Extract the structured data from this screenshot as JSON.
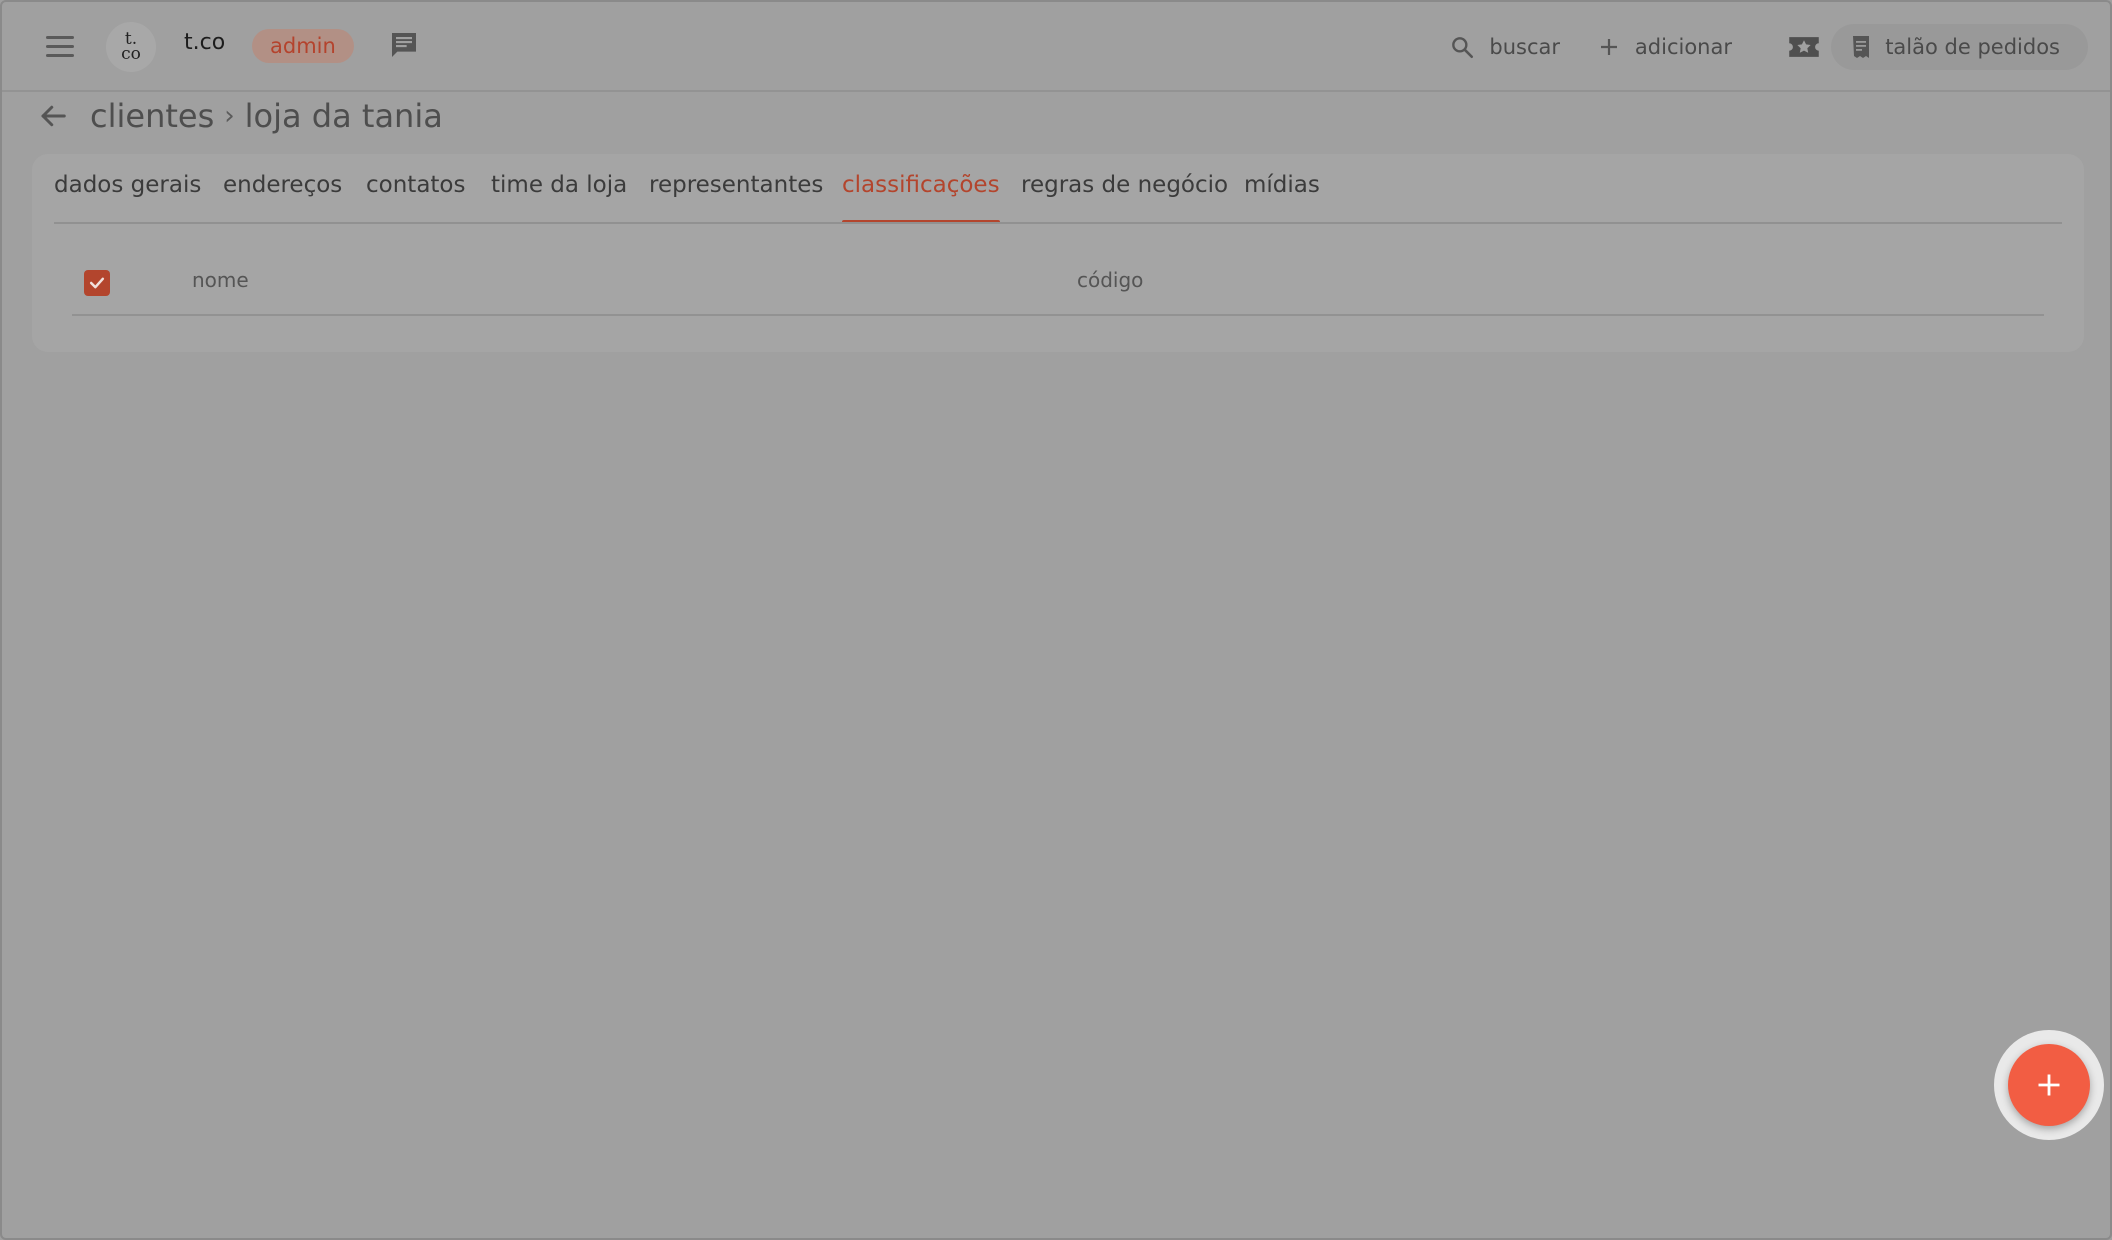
{
  "header": {
    "logo_text": "t.co",
    "company_name": "t.co",
    "role_badge": "admin",
    "search_label": "buscar",
    "add_label": "adicionar",
    "order_book_label": "talão de pedidos"
  },
  "breadcrumb": {
    "parent": "clientes",
    "separator": "›",
    "current": "loja da tania"
  },
  "tabs": [
    {
      "label": "dados gerais",
      "active": false
    },
    {
      "label": "endereços",
      "active": false
    },
    {
      "label": "contatos",
      "active": false
    },
    {
      "label": "time da loja",
      "active": false
    },
    {
      "label": "representantes",
      "active": false
    },
    {
      "label": "classificações",
      "active": true
    },
    {
      "label": "regras de negócio",
      "active": false
    },
    {
      "label": "mídias",
      "active": false
    }
  ],
  "table": {
    "select_all_checked": true,
    "columns": [
      "nome",
      "código"
    ]
  },
  "colors": {
    "accent": "#b3452d",
    "fab": "#f25d43",
    "overlay_background": "#a0a0a0"
  }
}
